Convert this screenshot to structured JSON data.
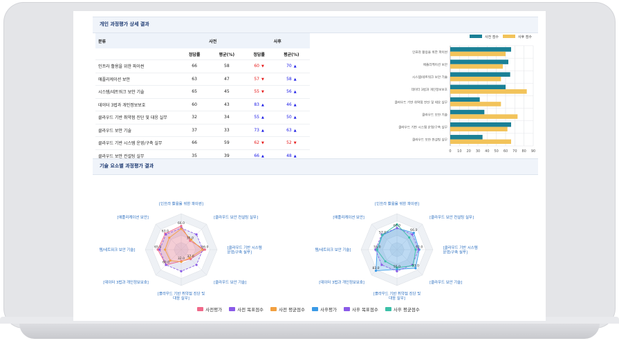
{
  "section1": {
    "title": "개인 과정평가 상세 결과"
  },
  "table": {
    "col_category": "분류",
    "col_pre": "사전",
    "col_post": "사후",
    "sub_headers": [
      "정답률",
      "평균(%)",
      "정답률",
      "평균(%)"
    ],
    "rows": [
      {
        "name": "인프라 활용을 위한 파이썬",
        "pre_rate": "66",
        "pre_avg": "58",
        "post_rate": "60",
        "post_rate_dir": "down",
        "post_avg": "70",
        "post_avg_dir": "up"
      },
      {
        "name": "애플리케이션 보안",
        "pre_rate": "63",
        "pre_avg": "47",
        "post_rate": "57",
        "post_rate_dir": "down",
        "post_avg": "58",
        "post_avg_dir": "up"
      },
      {
        "name": "시스템/네트워크 보안 기술",
        "pre_rate": "65",
        "pre_avg": "45",
        "post_rate": "55",
        "post_rate_dir": "down",
        "post_avg": "56",
        "post_avg_dir": "up"
      },
      {
        "name": "데이터 3법과 개인정보보호",
        "pre_rate": "60",
        "pre_avg": "43",
        "post_rate": "83",
        "post_rate_dir": "up",
        "post_avg": "46",
        "post_avg_dir": "up"
      },
      {
        "name": "클라우드 기반 취약점 진단 및 대응 실무",
        "pre_rate": "32",
        "pre_avg": "34",
        "post_rate": "55",
        "post_rate_dir": "up",
        "post_avg": "50",
        "post_avg_dir": "up"
      },
      {
        "name": "클라우드 보안 기술",
        "pre_rate": "37",
        "pre_avg": "33",
        "post_rate": "73",
        "post_rate_dir": "up",
        "post_avg": "63",
        "post_avg_dir": "up"
      },
      {
        "name": "클라우드 기반 시스템 운영/구축 실무",
        "pre_rate": "66",
        "pre_avg": "59",
        "post_rate": "62",
        "post_rate_dir": "down",
        "post_avg": "52",
        "post_avg_dir": "down"
      },
      {
        "name": "클라우드 보안 컨설팅 실무",
        "pre_rate": "35",
        "pre_avg": "39",
        "post_rate": "66",
        "post_rate_dir": "up",
        "post_avg": "48",
        "post_avg_dir": "up"
      }
    ]
  },
  "chart_data": [
    {
      "type": "bar",
      "orientation": "horizontal",
      "categories": [
        "인프라 활용을 위한 파이썬",
        "애플리케이션 보안",
        "시스템/네트워크 보안 기술",
        "데이터 3법과 개인정보보호",
        "클라우드 기반 취약점 진단 및 대응 실무",
        "클라우드 보안 기술",
        "클라우드 기반 시스템 운영/구축 실무",
        "클라우드 보안 컨설팅 실무"
      ],
      "series": [
        {
          "name": "사전 점수",
          "color": "#1a8096",
          "values": [
            66,
            63,
            65,
            60,
            32,
            37,
            66,
            35
          ]
        },
        {
          "name": "사후 점수",
          "color": "#f2c35a",
          "values": [
            60,
            57,
            55,
            83,
            55,
            73,
            62,
            66
          ]
        }
      ],
      "xlim": [
        0,
        90
      ],
      "xticks": [
        "0",
        "10",
        "20",
        "30",
        "40",
        "50",
        "60",
        "70",
        "80",
        "90"
      ],
      "legend": "top",
      "grid": true
    },
    {
      "type": "radar",
      "axes": [
        "[인프라 활용을 위한 파이썬]",
        "[클라우드 보안 컨설팅 실무]",
        "[클라우드 기반 시스템 운영/구축 실무]",
        "[클라우드 보안 기술]",
        "[클라우드 기반 취약점 진단 및 대응 실무]",
        "[데이터 3법과 개인정보보호]",
        "[시스템/네트워크 보안 기술]",
        "[애플리케이션 보안]"
      ],
      "max": 100,
      "series": [
        {
          "name": "사전평가",
          "color": "#f06a8a",
          "values": [
            66,
            35,
            66,
            37,
            32,
            60,
            65,
            63
          ]
        },
        {
          "name": "사전 목표점수",
          "color": "#8a5ae8",
          "values": [
            60,
            60,
            60,
            60,
            60,
            60,
            60,
            60
          ]
        },
        {
          "name": "사전 평균점수",
          "color": "#f2a040",
          "values": [
            58,
            39,
            59,
            33,
            34,
            43,
            45,
            47
          ]
        }
      ],
      "labels": [
        "66.0",
        "35.0",
        "66.0",
        "37.0",
        "32.0",
        "60.0",
        "65.0",
        "63.0"
      ]
    },
    {
      "type": "radar",
      "axes": [
        "[인프라 활용을 위한 파이썬]",
        "[클라우드 보안 컨설팅 실무]",
        "[클라우드 기반 시스템 운영/구축 실무]",
        "[클라우드 보안 기술]",
        "[클라우드 기반 취약점 진단 및 대응 실무]",
        "[데이터 3법과 개인정보보호]",
        "[시스템/네트워크 보안 기술]",
        "[애플리케이션 보안]"
      ],
      "max": 100,
      "series": [
        {
          "name": "사후평가",
          "color": "#3a9ae6",
          "values": [
            60,
            66,
            62,
            73,
            55,
            83,
            55,
            57
          ]
        },
        {
          "name": "사후 목표점수",
          "color": "#8a5ae8",
          "values": [
            60,
            60,
            60,
            60,
            60,
            60,
            60,
            60
          ]
        },
        {
          "name": "사후 평균점수",
          "color": "#3cc0a8",
          "values": [
            70,
            48,
            52,
            63,
            50,
            46,
            56,
            58
          ]
        }
      ],
      "labels": [
        "60.0",
        "66.0",
        "62.0",
        "73.0",
        "55.0",
        "83.0",
        "55.0",
        "57.0"
      ]
    }
  ],
  "section2": {
    "title": "기술 요소별 과정평가 결과"
  },
  "legend": [
    {
      "label": "사전평가",
      "color": "#f06a8a"
    },
    {
      "label": "사전 목표점수",
      "color": "#8a5ae8"
    },
    {
      "label": "사전 평균점수",
      "color": "#f2a040"
    },
    {
      "label": "사후평가",
      "color": "#3a9ae6"
    },
    {
      "label": "사후 목표점수",
      "color": "#8a5ae8"
    },
    {
      "label": "사후 평균점수",
      "color": "#3cc0a8"
    }
  ]
}
